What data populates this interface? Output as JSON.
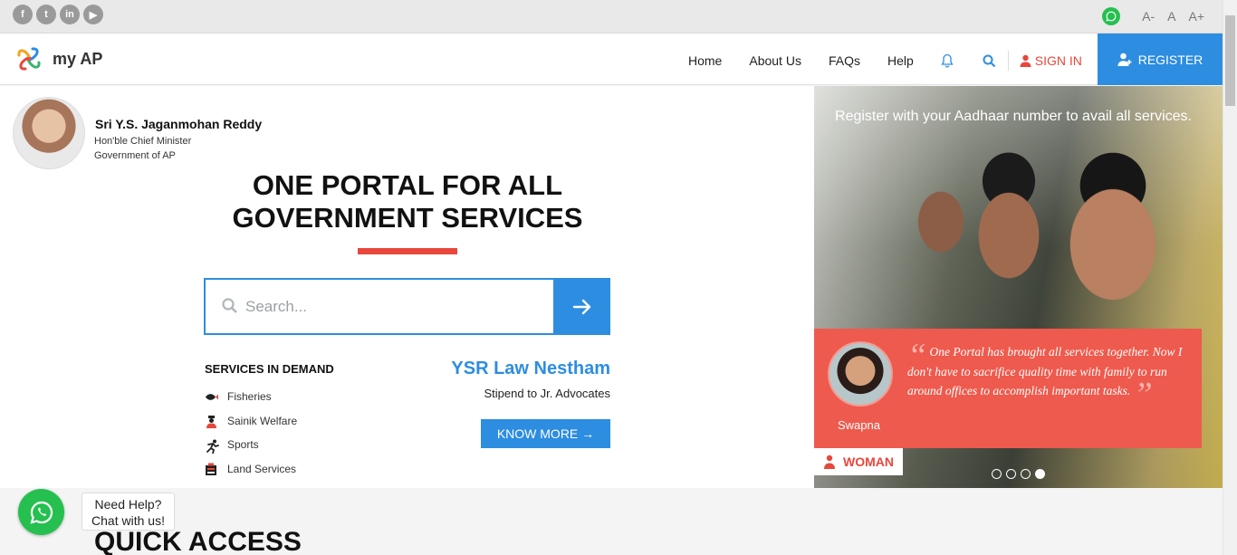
{
  "topbar": {
    "social": [
      {
        "icon": "facebook-icon",
        "glyph": "f"
      },
      {
        "icon": "twitter-icon",
        "glyph": "t"
      },
      {
        "icon": "linkedin-icon",
        "glyph": "in"
      },
      {
        "icon": "youtube-icon",
        "glyph": "▶"
      }
    ],
    "font_decrease": "A-",
    "font_normal": "A",
    "font_increase": "A+"
  },
  "header": {
    "logo_text": "my AP",
    "nav": [
      "Home",
      "About Us",
      "FAQs",
      "Help"
    ],
    "signin_label": "SIGN IN",
    "register_label": "REGISTER"
  },
  "hero": {
    "cm_name": "Sri Y.S. Jaganmohan Reddy",
    "cm_role_1": "Hon'ble Chief Minister",
    "cm_role_2": "Government of AP",
    "headline_1": "ONE PORTAL FOR ALL",
    "headline_2": "GOVERNMENT SERVICES",
    "search_placeholder": "Search...",
    "services_title": "SERVICES IN DEMAND",
    "services": [
      "Fisheries",
      "Sainik Welfare",
      "Sports",
      "Land Services"
    ],
    "promo_title": "YSR Law Nestham",
    "promo_subtitle": "Stipend to Jr. Advocates",
    "know_more_label": "KNOW MORE →"
  },
  "banner": {
    "caption": "Register with your Aadhaar number to avail all services.",
    "quote": "One Portal has brought all services together. Now I don't have to sacrifice quality time with family to run around offices to accomplish important tasks.",
    "quote_author": "Swapna",
    "category_tag": "WOMAN",
    "slide_count": 4,
    "active_slide": 4
  },
  "help_bubble": {
    "line1": "Need Help?",
    "line2": "Chat with us!"
  },
  "quick_access_title": "QUICK ACCESS",
  "colors": {
    "primary_blue": "#2d8de0",
    "accent_red": "#e8473c",
    "quote_card": "#ee5a4d",
    "whatsapp_green": "#25c04f"
  }
}
